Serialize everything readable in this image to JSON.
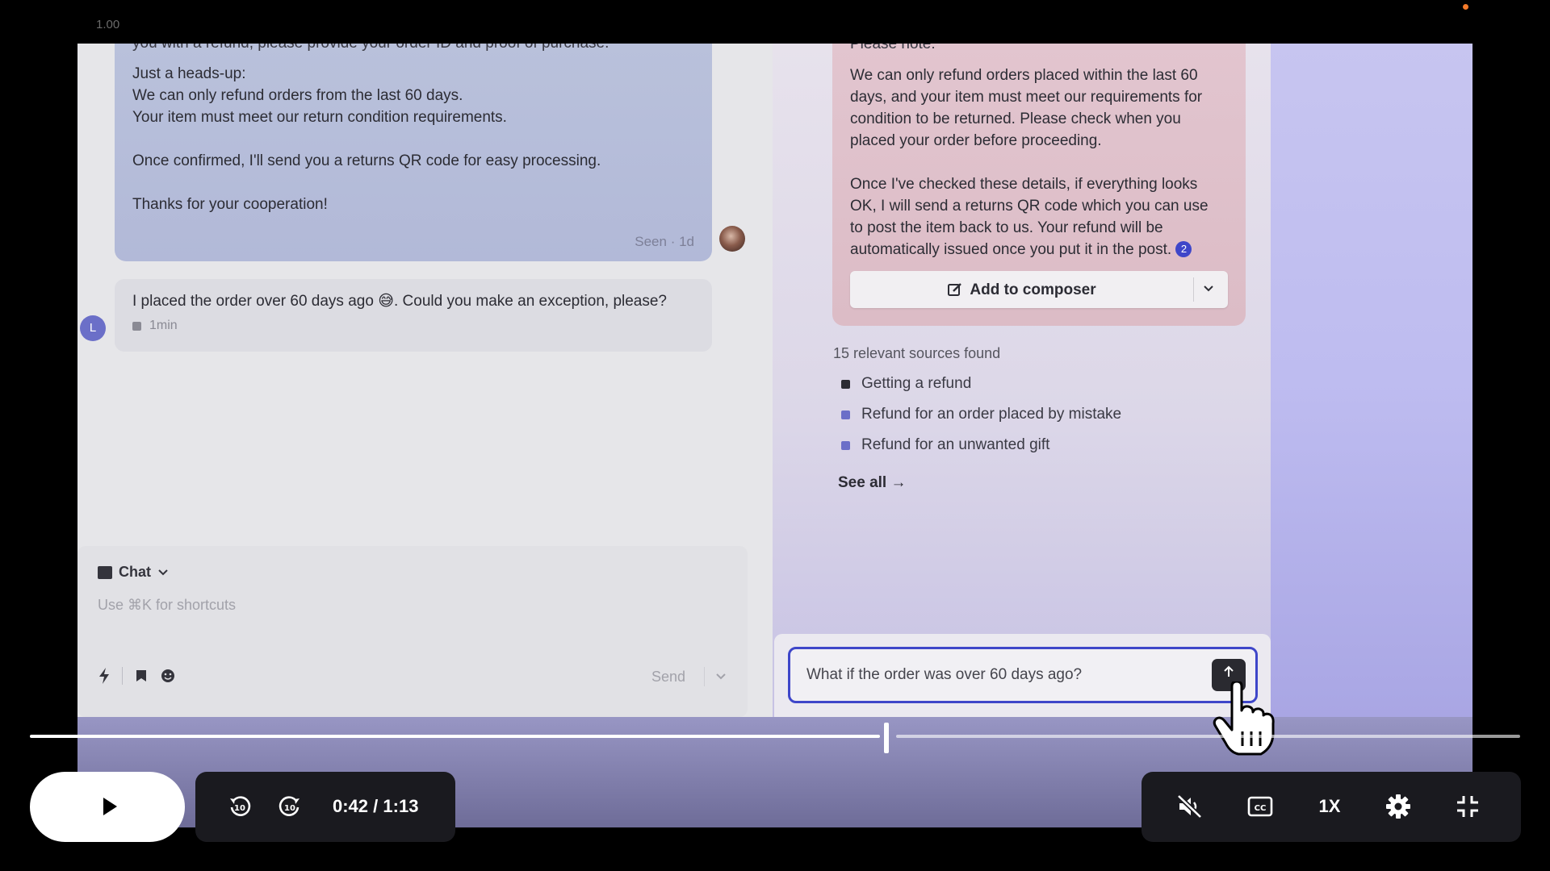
{
  "player": {
    "version_label": "1.00",
    "current_time": "0:42",
    "duration": "/ 1:13",
    "progress_fraction": 0.575,
    "speed_label": "1X",
    "icons": [
      "play-icon",
      "rewind-10-icon",
      "forward-10-icon",
      "mute-icon",
      "captions-icon",
      "settings-icon",
      "fullscreen-exit-icon"
    ]
  },
  "conversation": {
    "agent_message": {
      "cut_line": "you with a refund, please provide your order ID and proof of purchase.",
      "lines_a": [
        "Just a heads-up:",
        "We can only refund orders from the last 60 days.",
        "Your item must meet our return condition requirements."
      ],
      "line_b": "Once confirmed, I'll send you a returns QR code for easy processing.",
      "line_c": "Thanks for your cooperation!",
      "status": "Seen · 1d"
    },
    "user_message": {
      "text": "I placed the order over 60 days ago 😅. Could you make an exception, please?",
      "time": "1min",
      "avatar_initial": "L"
    },
    "composer": {
      "mode_label": "Chat",
      "hint": "Use ⌘K for shortcuts",
      "send_label": "Send"
    }
  },
  "copilot": {
    "cut_line": "Please note:",
    "para1": [
      "We can only refund orders placed within the last 60",
      "days, and your item must meet our requirements for",
      "condition to be returned. Please check when you",
      "placed your order before proceeding."
    ],
    "para2": [
      "Once I've checked these details, if everything looks",
      "OK, I will send a returns QR code which you can use",
      "to post the item back to us. Your refund will be",
      "automatically issued once you put it in the post."
    ],
    "citation": "2",
    "add_button": "Add to composer",
    "sources_heading": "15 relevant sources found",
    "sources": [
      "Getting a refund",
      "Refund for an order placed by mistake",
      "Refund for an unwanted gift"
    ],
    "see_all": "See all →",
    "ask_input_value": "What if the order was over 60 days ago?"
  }
}
